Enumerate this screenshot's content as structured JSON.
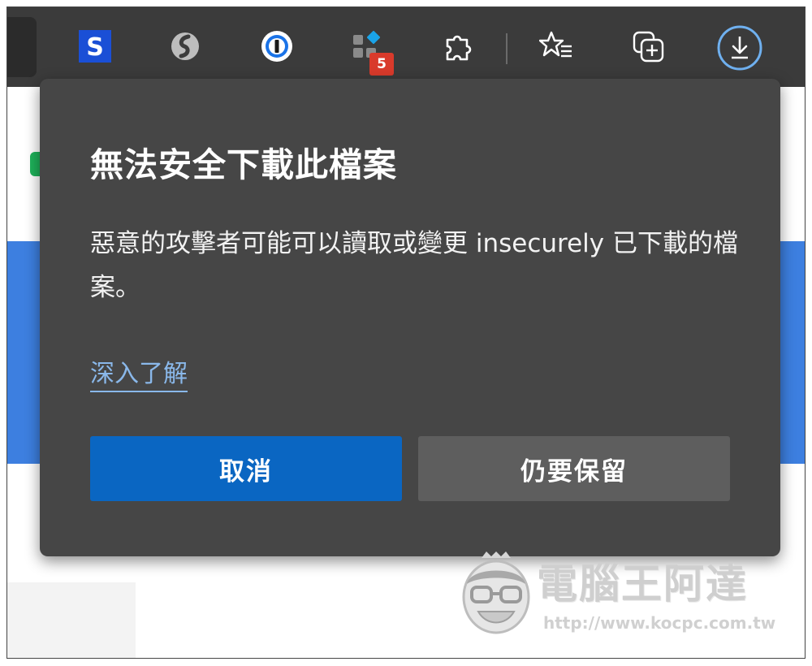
{
  "toolbar": {
    "icons": [
      {
        "name": "s-extension-icon",
        "label": "S"
      },
      {
        "name": "simplenote-icon"
      },
      {
        "name": "password-manager-icon"
      },
      {
        "name": "extension-grid-icon",
        "badge": "5"
      },
      {
        "name": "extensions-puzzle-icon"
      },
      {
        "name": "favorites-icon"
      },
      {
        "name": "collections-icon"
      },
      {
        "name": "downloads-icon"
      }
    ],
    "badge_count": "5",
    "s_label": "S"
  },
  "download_popup": {
    "title": "無法安全下載此檔案",
    "message": "惡意的攻擊者可能可以讀取或變更 insecurely 已下載的檔案。",
    "learn_more": "深入了解",
    "cancel_label": "取消",
    "keep_label": "仍要保留"
  },
  "watermark": {
    "text": "電腦王阿達",
    "url": "http://www.kocpc.com.tw"
  },
  "colors": {
    "toolbar_bg": "#3b3b3b",
    "popup_bg": "#464646",
    "primary_button": "#0a66c2",
    "secondary_button": "#5e5e5e",
    "link": "#8ab8ea",
    "badge": "#d93a2b",
    "page_accent": "#3d7fe0"
  }
}
